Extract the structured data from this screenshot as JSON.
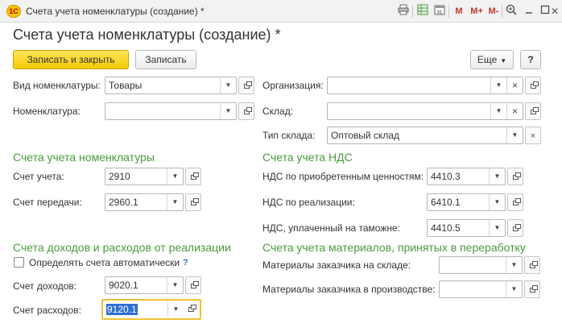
{
  "window": {
    "app_logo": "1С",
    "title": "Счета учета номенклатуры (создание) *",
    "toolbar_icons": [
      "print-icon",
      "spreadsheet-icon",
      "calendar-icon",
      "memory-m-icon",
      "memory-mplus-icon",
      "memory-mminus-icon",
      "zoom-icon",
      "minimize-icon",
      "maximize-icon",
      "close-icon"
    ],
    "m": "M",
    "m_plus": "M+",
    "m_minus": "M-",
    "close_glyph": "✕"
  },
  "form": {
    "title": "Счета учета номенклатуры (создание) *"
  },
  "buttons": {
    "save_close": "Записать и закрыть",
    "save": "Записать",
    "more": "Еще",
    "help": "?"
  },
  "fields_left": {
    "vid_label": "Вид номенклатуры:",
    "vid_value": "Товары",
    "nomen_label": "Номенклатура:",
    "nomen_value": ""
  },
  "fields_right": {
    "org_label": "Организация:",
    "org_value": "",
    "sklad_label": "Склад:",
    "sklad_value": "",
    "tip_label": "Тип склада:",
    "tip_value": "Оптовый склад"
  },
  "section_nomen": {
    "title": "Счета учета номенклатуры",
    "uchet_label": "Счет учета:",
    "uchet_value": "2910",
    "peredachi_label": "Счет передачи:",
    "peredachi_value": "2960.1"
  },
  "section_nds": {
    "title": "Счета учета НДС",
    "priobr_label": "НДС по приобретенным ценностям:",
    "priobr_value": "4410.3",
    "realiz_label": "НДС по реализации:",
    "realiz_value": "6410.1",
    "tamozh_label": "НДС, уплаченный на таможне:",
    "tamozh_value": "4410.5"
  },
  "section_income": {
    "title": "Счета доходов и расходов от реализации",
    "auto_label": "Определять счета автоматически",
    "auto_checked": false,
    "help": "?",
    "dohod_label": "Счет доходов:",
    "dohod_value": "9020.1",
    "rashod_label": "Счет расходов:",
    "rashod_value": "9120.1"
  },
  "section_materials": {
    "title": "Счета учета материалов, принятых в переработку",
    "na_sklade_label": "Материалы заказчика на складе:",
    "na_sklade_value": "",
    "v_proizv_label": "Материалы заказчика в производстве:",
    "v_proizv_value": ""
  },
  "glyphs": {
    "dropdown": "▼",
    "clear": "×"
  },
  "colors": {
    "section_green": "#4a9a3d",
    "primary_yellow": "#f4cb00",
    "focus_border": "#f1c232",
    "selection_blue": "#2f6fd6"
  }
}
